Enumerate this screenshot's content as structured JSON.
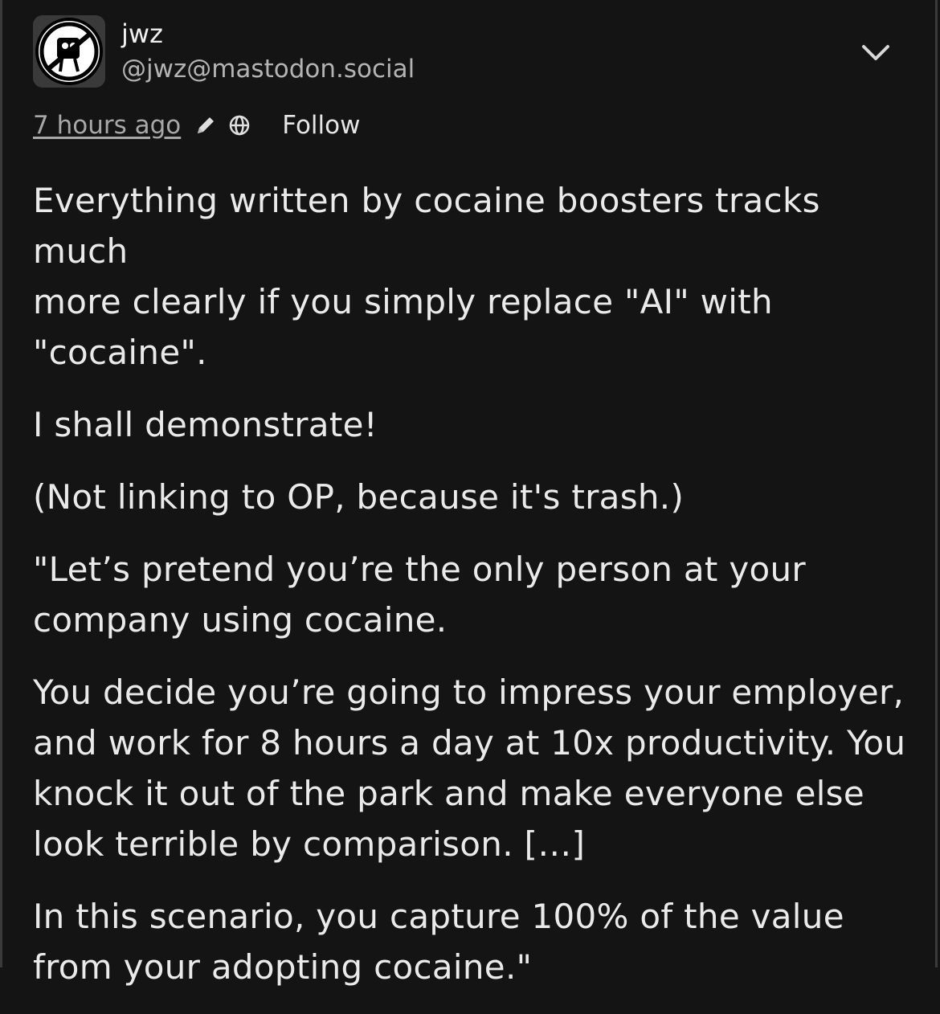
{
  "post": {
    "author": {
      "display_name": "jwz",
      "handle": "@jwz@mastodon.social",
      "avatar_icon": "no-symbol-figure-icon"
    },
    "meta": {
      "timestamp": "7 hours ago",
      "edited_icon": "pencil-icon",
      "visibility_icon": "globe-icon",
      "follow_label": "Follow"
    },
    "menu_icon": "chevron-down-icon",
    "paragraphs": [
      "Everything written by cocaine boosters tracks much\nmore clearly if you simply replace \"AI\" with\n\"cocaine\".",
      "I shall demonstrate!",
      "(Not linking to OP, because it's trash.)",
      "\"Let’s pretend you’re the only person at your\ncompany using cocaine.",
      "You decide you’re going to impress your employer,\nand work for 8 hours a day at 10x productivity. You\nknock it out of the park and make everyone else\nlook terrible by comparison. […]",
      "In this scenario, you capture 100% of the value\nfrom your adopting cocaine.\""
    ]
  },
  "colors": {
    "background": "#141414",
    "text": "#eaeaea",
    "muted": "#a8a8a8"
  }
}
